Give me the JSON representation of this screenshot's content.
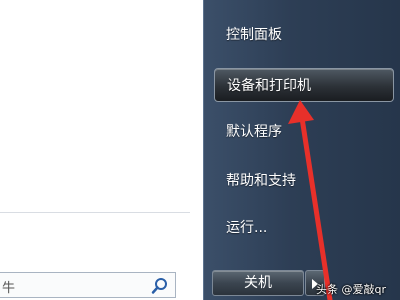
{
  "search": {
    "text": "牛"
  },
  "menu": {
    "items": [
      {
        "label": "控制面板"
      },
      {
        "label": "设备和打印机"
      },
      {
        "label": "默认程序"
      },
      {
        "label": "帮助和支持"
      },
      {
        "label": "运行..."
      }
    ],
    "selected": "设备和打印机"
  },
  "shutdown": {
    "label": "关机"
  },
  "watermark": {
    "text": "头条 @爱敲qr"
  },
  "colors": {
    "pane_dark": "#2d3e55",
    "arrow_red": "#e8302a"
  }
}
